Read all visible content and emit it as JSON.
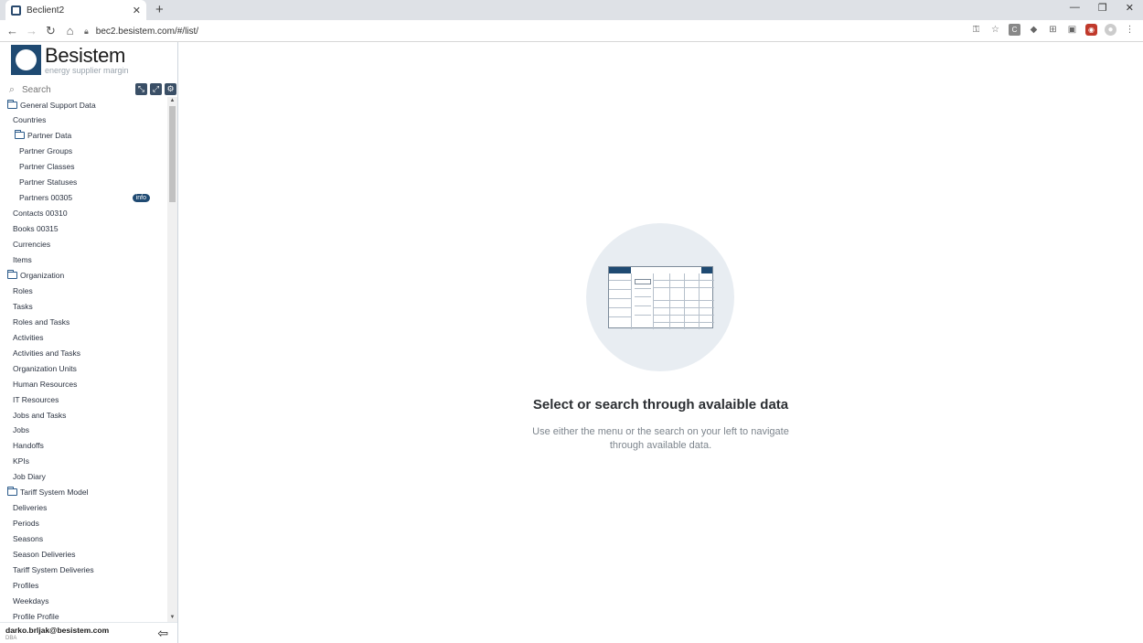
{
  "browser": {
    "tab_title": "Beclient2",
    "url": "bec2.besistem.com/#/list/"
  },
  "brand": {
    "name": "Besistem",
    "subtitle": "energy supplier margin"
  },
  "search": {
    "placeholder": "Search"
  },
  "tree": [
    {
      "label": "General Support Data",
      "type": "folder",
      "level": 0
    },
    {
      "label": "Countries",
      "type": "item",
      "level": 1
    },
    {
      "label": "Partner Data",
      "type": "folder",
      "level": 1
    },
    {
      "label": "Partner Groups",
      "type": "item",
      "level": 2
    },
    {
      "label": "Partner Classes",
      "type": "item",
      "level": 2
    },
    {
      "label": "Partner Statuses",
      "type": "item",
      "level": 2
    },
    {
      "label": "Partners 00305",
      "type": "item",
      "level": 2,
      "badge": "info"
    },
    {
      "label": "Contacts 00310",
      "type": "item",
      "level": 1
    },
    {
      "label": "Books 00315",
      "type": "item",
      "level": 1
    },
    {
      "label": "Currencies",
      "type": "item",
      "level": 1
    },
    {
      "label": "Items",
      "type": "item",
      "level": 1
    },
    {
      "label": "Organization",
      "type": "folder",
      "level": 0
    },
    {
      "label": "Roles",
      "type": "item",
      "level": 1
    },
    {
      "label": "Tasks",
      "type": "item",
      "level": 1
    },
    {
      "label": "Roles and Tasks",
      "type": "item",
      "level": 1
    },
    {
      "label": "Activities",
      "type": "item",
      "level": 1
    },
    {
      "label": "Activities and Tasks",
      "type": "item",
      "level": 1
    },
    {
      "label": "Organization Units",
      "type": "item",
      "level": 1
    },
    {
      "label": "Human Resources",
      "type": "item",
      "level": 1
    },
    {
      "label": "IT Resources",
      "type": "item",
      "level": 1
    },
    {
      "label": "Jobs and Tasks",
      "type": "item",
      "level": 1
    },
    {
      "label": "Jobs",
      "type": "item",
      "level": 1
    },
    {
      "label": "Handoffs",
      "type": "item",
      "level": 1
    },
    {
      "label": "KPIs",
      "type": "item",
      "level": 1
    },
    {
      "label": "Job Diary",
      "type": "item",
      "level": 1
    },
    {
      "label": "Tariff System Model",
      "type": "folder",
      "level": 0
    },
    {
      "label": "Deliveries",
      "type": "item",
      "level": 1
    },
    {
      "label": "Periods",
      "type": "item",
      "level": 1
    },
    {
      "label": "Seasons",
      "type": "item",
      "level": 1
    },
    {
      "label": "Season Deliveries",
      "type": "item",
      "level": 1
    },
    {
      "label": "Tariff System Deliveries",
      "type": "item",
      "level": 1
    },
    {
      "label": "Profiles",
      "type": "item",
      "level": 1
    },
    {
      "label": "Weekdays",
      "type": "item",
      "level": 1
    },
    {
      "label": "Profile Profile",
      "type": "item",
      "level": 1
    }
  ],
  "user": {
    "email": "darko.brljak@besistem.com",
    "role": "DBA"
  },
  "empty_state": {
    "title": "Select or search through avalaible data",
    "description": "Use either the menu or the search on your left to navigate through available data."
  },
  "colors": {
    "brand": "#1f4a72",
    "sidebar_border": "#cfd6dd",
    "illustration_bg": "#e8edf2"
  }
}
